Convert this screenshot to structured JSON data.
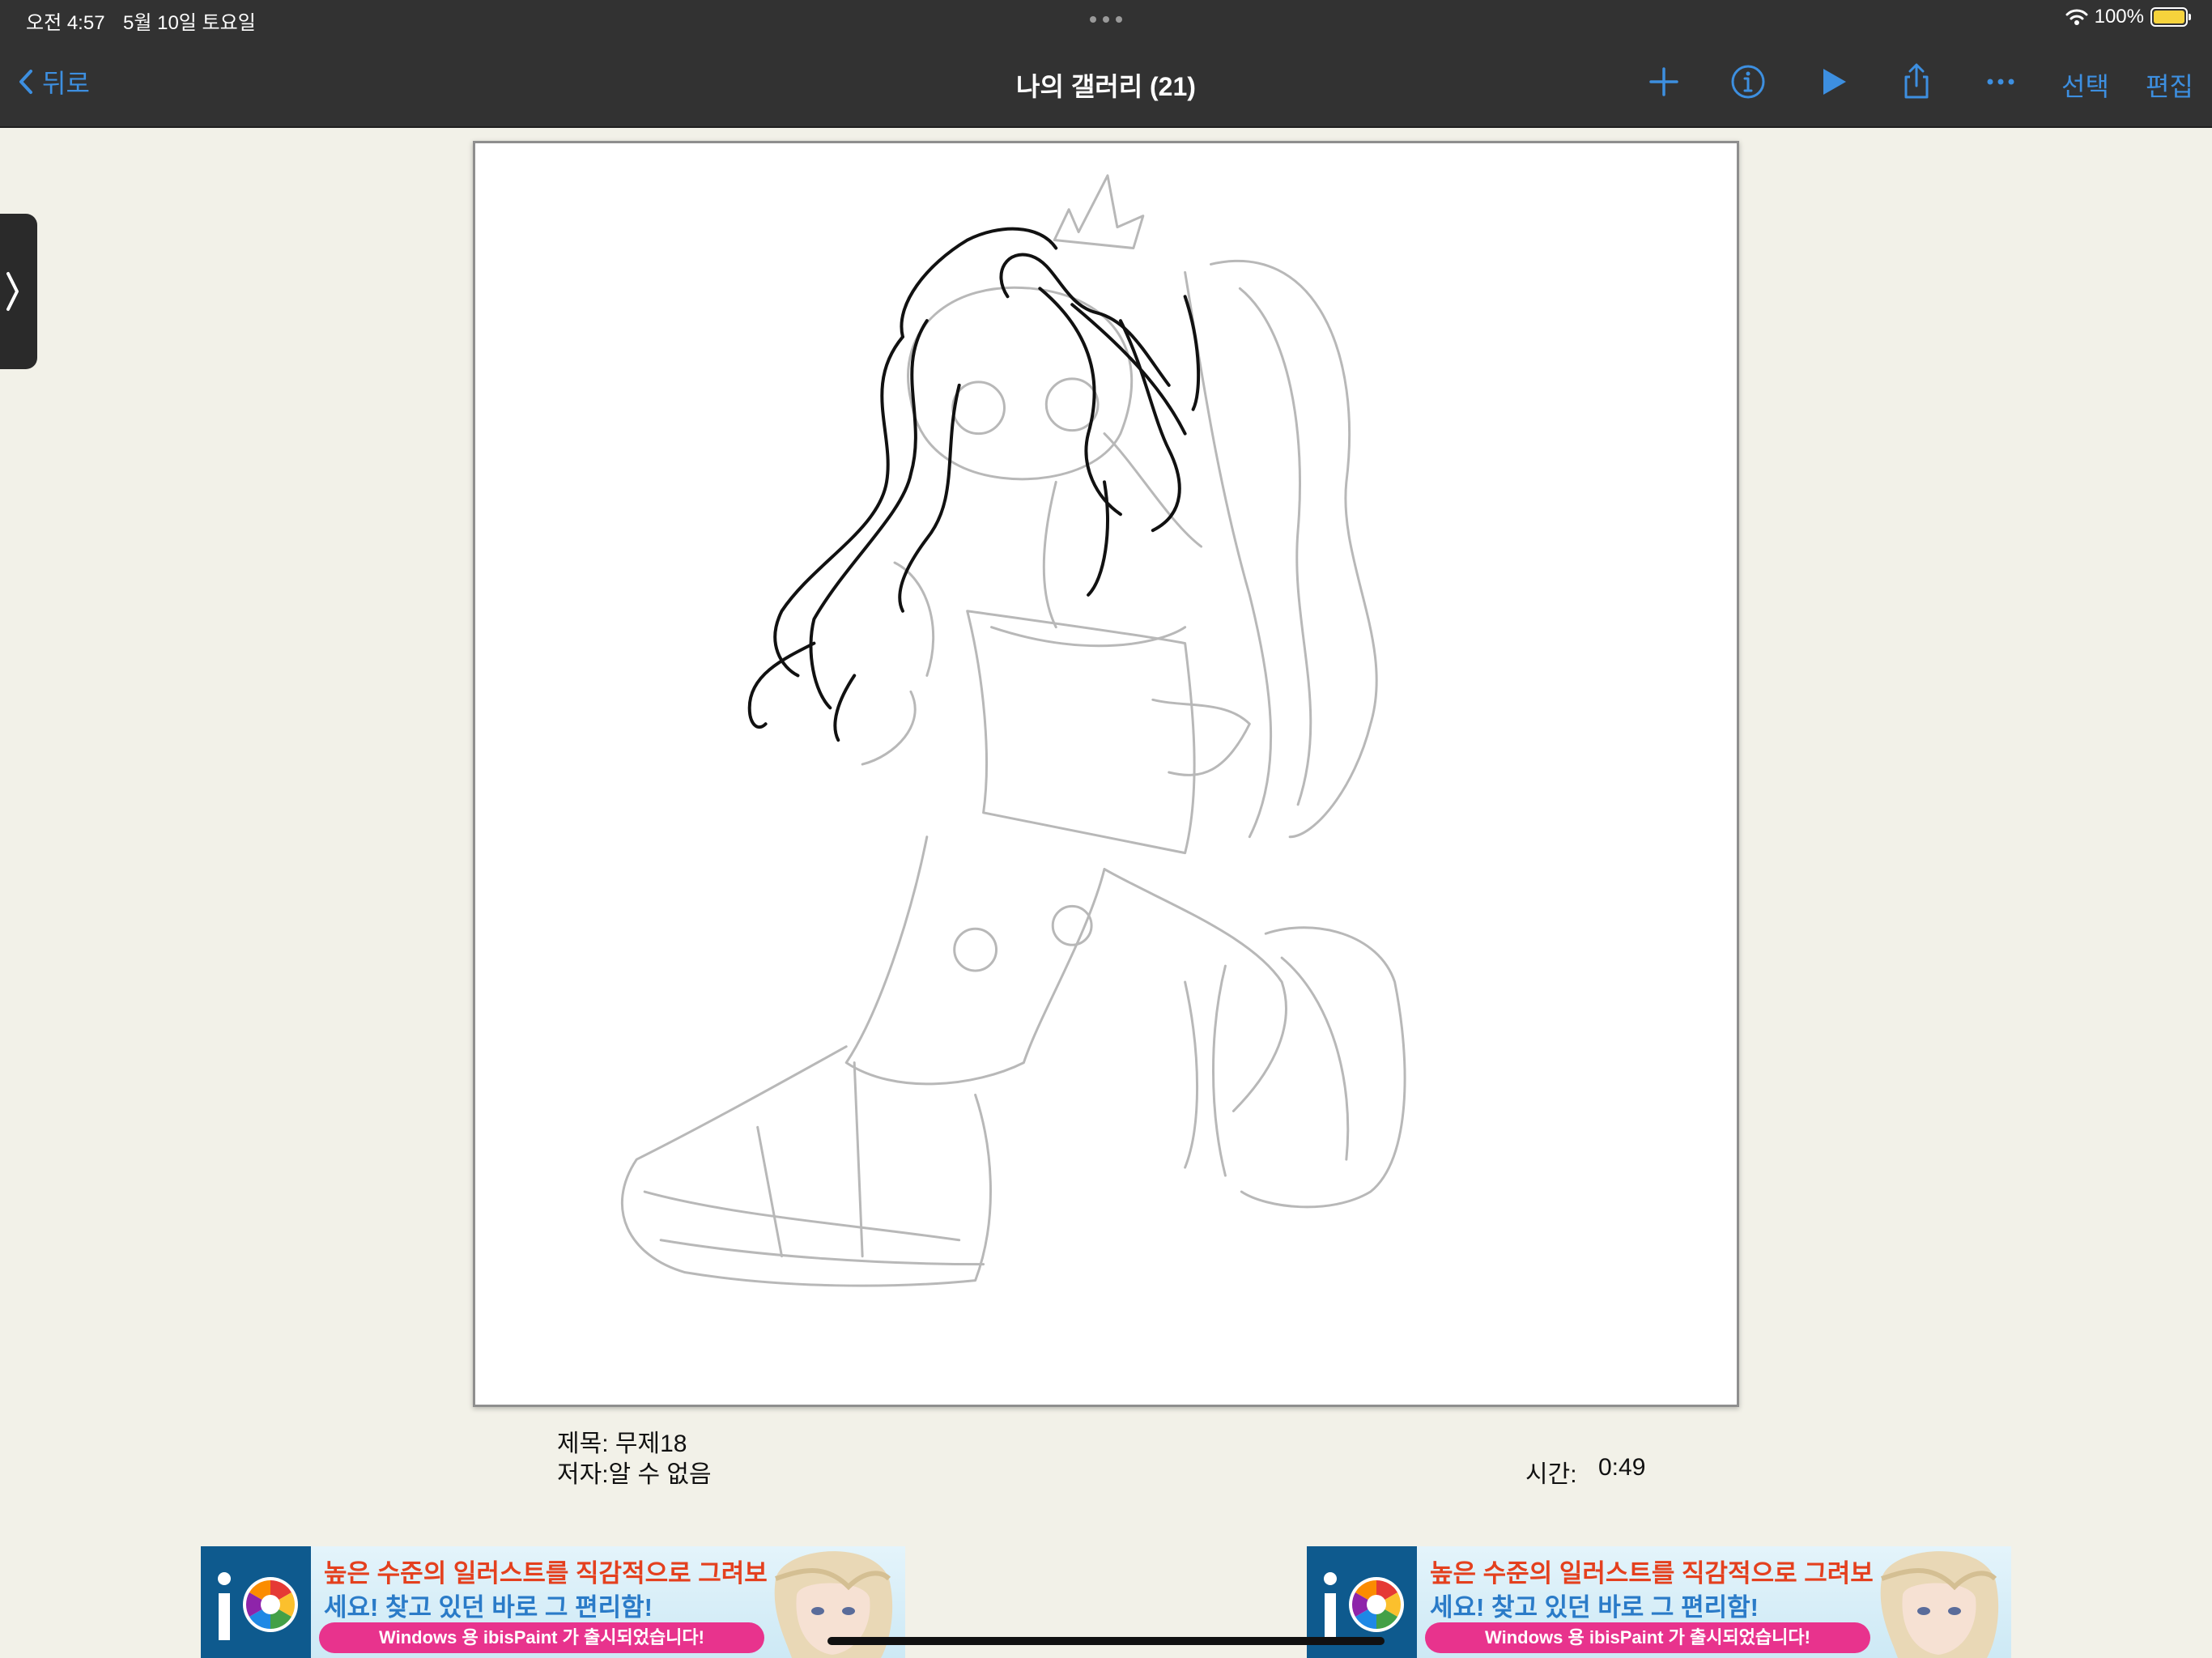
{
  "status_bar": {
    "time": "오전 4:57",
    "date": "5월 10일 토요일",
    "battery": "100%",
    "icons": [
      "wifi-icon",
      "battery-charging-icon"
    ]
  },
  "nav": {
    "back_label": "뒤로",
    "title": "나의 갤러리 (21)",
    "select_label": "선택",
    "edit_label": "편집",
    "icons": [
      "chevron-left-icon",
      "plus-icon",
      "info-icon",
      "play-icon",
      "share-icon",
      "more-icon"
    ]
  },
  "artwork": {
    "title_line": "제목: 무제18",
    "author_line": "저자:알 수 없음",
    "time_label": "시간:",
    "time_value": "0:49"
  },
  "ads": [
    {
      "line1": "높은 수준의 일러스트를 직감적으로 그려보",
      "line2": "세요! 찾고 있던 바로 그 편리함!",
      "banner": "Windows 용 ibisPaint 가 출시되었습니다!"
    },
    {
      "line1": "높은 수준의 일러스트를 직감적으로 그려보",
      "line2": "세요! 찾고 있던 바로 그 편리함!",
      "banner": "Windows 용 ibisPaint 가 출시되었습니다!"
    }
  ],
  "colors": {
    "accent": "#3d8fe0",
    "bar_background": "#323232",
    "page_background": "#f2f1e8"
  }
}
